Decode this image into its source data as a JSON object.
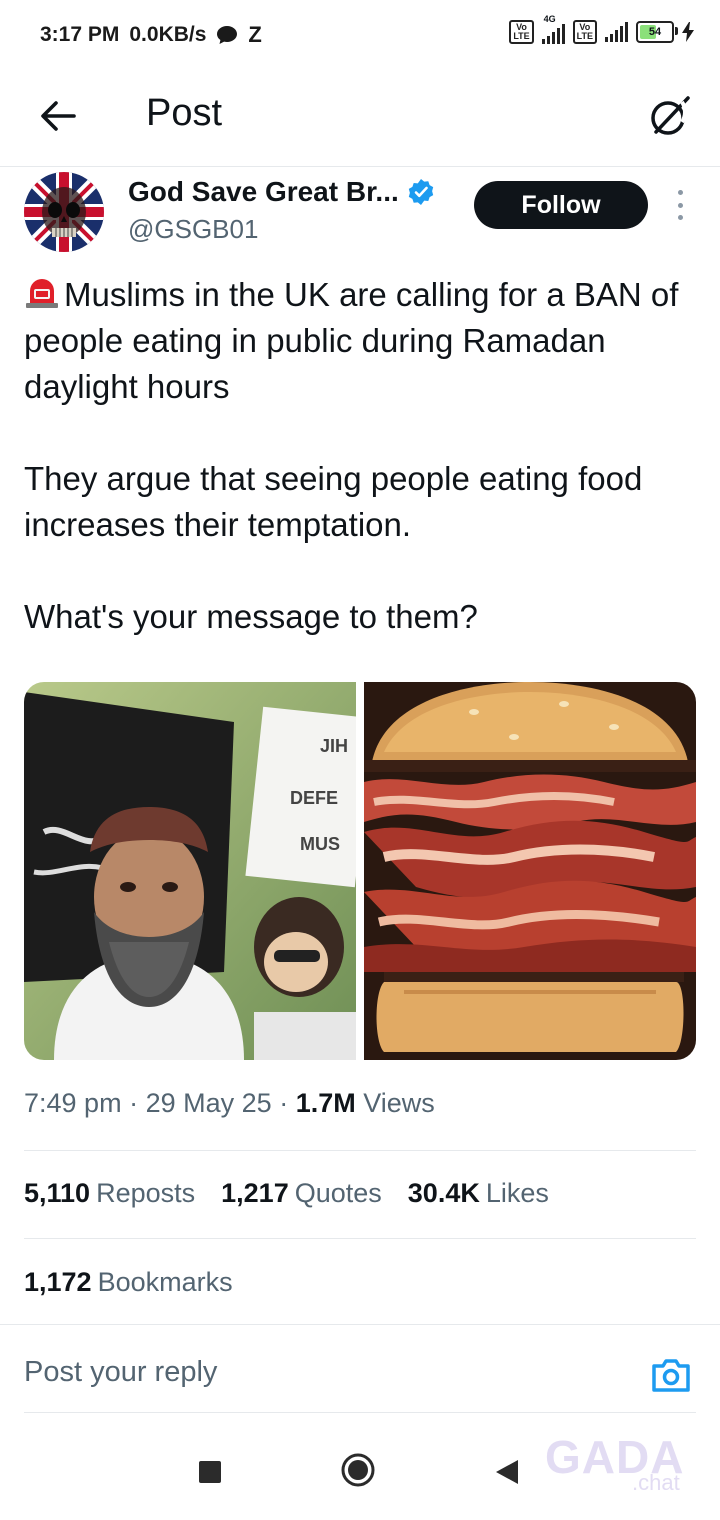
{
  "status_bar": {
    "time": "3:17 PM",
    "speed": "0.0KB/s",
    "network_label": "4G",
    "volte_label": "Vo LTE",
    "battery": "54"
  },
  "header": {
    "title": "Post",
    "back_icon": "arrow-left-icon",
    "grok_icon": "grok-icon"
  },
  "author": {
    "name": "God Save Great Br...",
    "handle": "@GSGB01",
    "verified": true,
    "follow_label": "Follow"
  },
  "tweet": {
    "line1": "Muslims in the UK are calling for a BAN of people eating in public during Ramadan daylight hours",
    "line2": "They argue that seeing people eating food increases their temptation.",
    "line3": "What's your message to them?",
    "sign_text": [
      "JIH",
      "DEFE",
      "MUS"
    ]
  },
  "meta": {
    "time": "7:49 pm",
    "date": "29 May 25",
    "views_count": "1.7M",
    "views_label": "Views",
    "separator": "·"
  },
  "stats": {
    "reposts_count": "5,110",
    "reposts_label": "Reposts",
    "quotes_count": "1,217",
    "quotes_label": "Quotes",
    "likes_count": "30.4K",
    "likes_label": "Likes",
    "bookmarks_count": "1,172",
    "bookmarks_label": "Bookmarks"
  },
  "reply": {
    "placeholder": "Post your reply"
  },
  "watermark": {
    "brand": "GADA",
    "sub": ".chat"
  },
  "colors": {
    "text": "#0f1419",
    "secondary": "#536471",
    "divider": "#e6e9ec",
    "verified": "#1d9bf0",
    "follow_bg": "#0f1419"
  }
}
